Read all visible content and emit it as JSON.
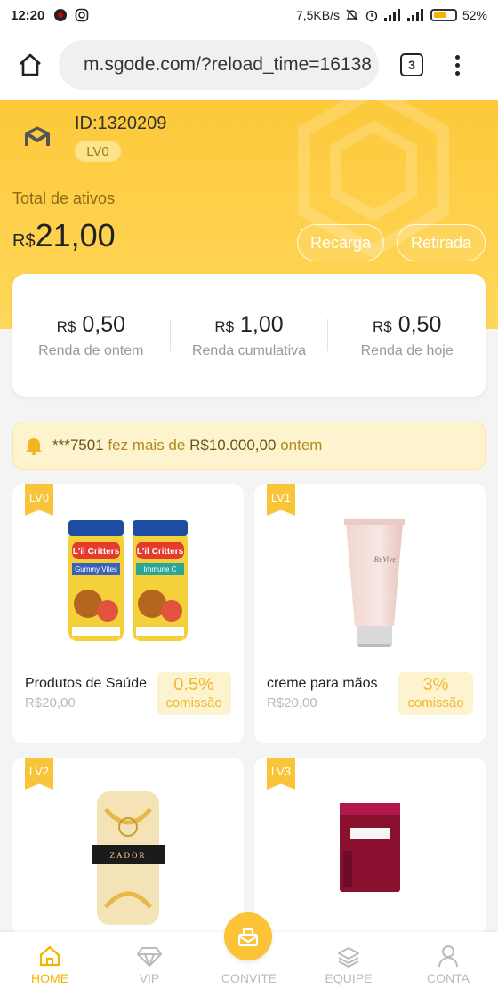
{
  "status_bar": {
    "time": "12:20",
    "net_speed": "7,5KB/s",
    "battery": "52%",
    "battery_level": 0.52
  },
  "browser": {
    "url": "m.sgode.com/?reload_time=16138",
    "tab_count": "3"
  },
  "account": {
    "user_id": "ID:1320209",
    "level": "LV0",
    "assets_label": "Total de ativos",
    "assets_currency": "R$",
    "assets_value": "21,00",
    "recarga_label": "Recarga",
    "retirada_label": "Retirada"
  },
  "stats": [
    {
      "currency": "R$",
      "value": "0,50",
      "label": "Renda de ontem"
    },
    {
      "currency": "R$",
      "value": "1,00",
      "label": "Renda cumulativa"
    },
    {
      "currency": "R$",
      "value": "0,50",
      "label": "Renda de hoje"
    }
  ],
  "notice": {
    "user": "***7501",
    "mid": "fez mais de",
    "amount": "R$10.000,00",
    "end": "ontem"
  },
  "products": [
    {
      "level": "LV0",
      "name": "Produtos de Saúde",
      "price": "R$20,00",
      "commission_pct": "0.5%",
      "commission_label": "comissão"
    },
    {
      "level": "LV1",
      "name": "creme para mãos",
      "price": "R$20,00",
      "commission_pct": "3%",
      "commission_label": "comissão"
    },
    {
      "level": "LV2"
    },
    {
      "level": "LV3"
    }
  ],
  "product_images": {
    "p0_labels": [
      "L'il Critters",
      "L'il Critters"
    ],
    "p0_sub": [
      "Gummy Vites",
      "Immune C"
    ],
    "p1_brand": "ReVive",
    "p2_brand": "ZADOR"
  },
  "nav": [
    {
      "label": "HOME",
      "icon": "home-icon",
      "active": true
    },
    {
      "label": "VIP",
      "icon": "diamond-icon",
      "active": false
    },
    {
      "label": "CONVITE",
      "icon": "invite-icon",
      "active": false
    },
    {
      "label": "EQUIPE",
      "icon": "layers-icon",
      "active": false
    },
    {
      "label": "CONTA",
      "icon": "user-icon",
      "active": false
    }
  ],
  "colors": {
    "accent": "#f2b400",
    "header_bg": "#fdc93a",
    "notice_bg": "#fef3cf"
  }
}
